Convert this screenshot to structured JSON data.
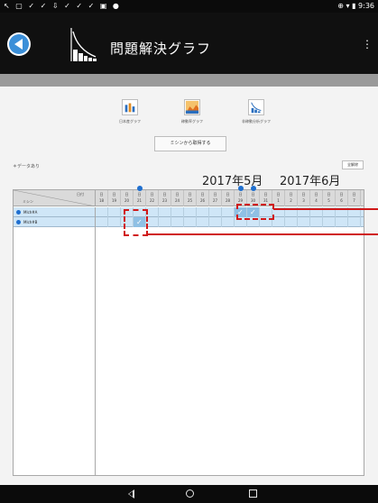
{
  "status_bar": {
    "left_icons": "↖ ▢ ✓ ✓ ⇩ ✓ ✓ ✓ ▣ ●",
    "time": "9:36",
    "right_icons": "⊕ ▾ ▮"
  },
  "app_bar": {
    "title": "問題解決グラフ",
    "menu_icon": "⋮"
  },
  "chart_buttons": [
    {
      "label": "日本産グラフ",
      "icon": "bar-chart-icon"
    },
    {
      "label": "稼動率グラフ",
      "icon": "landscape-chart-icon"
    },
    {
      "label": "非稼動分析グラフ",
      "icon": "pareto-chart-icon"
    }
  ],
  "get_from_machine_label": "ミシンから取得する",
  "data_label": "＊データあり",
  "delete_all_label": "全解除",
  "months": [
    "2017年5月",
    "2017年6月"
  ],
  "grid_header": {
    "corner_top": "日付",
    "corner_bottom": "ミシン"
  },
  "days": [
    {
      "w": "日",
      "d": "18"
    },
    {
      "w": "日",
      "d": "19"
    },
    {
      "w": "日",
      "d": "20"
    },
    {
      "w": "日",
      "d": "21"
    },
    {
      "w": "日",
      "d": "22"
    },
    {
      "w": "日",
      "d": "23"
    },
    {
      "w": "日",
      "d": "24"
    },
    {
      "w": "日",
      "d": "25"
    },
    {
      "w": "日",
      "d": "26"
    },
    {
      "w": "日",
      "d": "27"
    },
    {
      "w": "日",
      "d": "28"
    },
    {
      "w": "日",
      "d": "29"
    },
    {
      "w": "日",
      "d": "30"
    },
    {
      "w": "日",
      "d": "31"
    },
    {
      "w": "日",
      "d": "1"
    },
    {
      "w": "日",
      "d": "2"
    },
    {
      "w": "日",
      "d": "3"
    },
    {
      "w": "日",
      "d": "4"
    },
    {
      "w": "日",
      "d": "5"
    },
    {
      "w": "日",
      "d": "6"
    },
    {
      "w": "日",
      "d": "7"
    }
  ],
  "machines": [
    {
      "name": "Mlch#A",
      "checked": [
        11,
        12
      ]
    },
    {
      "name": "Mlch#B",
      "checked": [
        3
      ]
    }
  ],
  "colors": {
    "accent": "#3b8fd8",
    "highlight_red": "#d01818",
    "row_bg": "#cfe6f7",
    "checked_cell": "#8fc0e4"
  }
}
